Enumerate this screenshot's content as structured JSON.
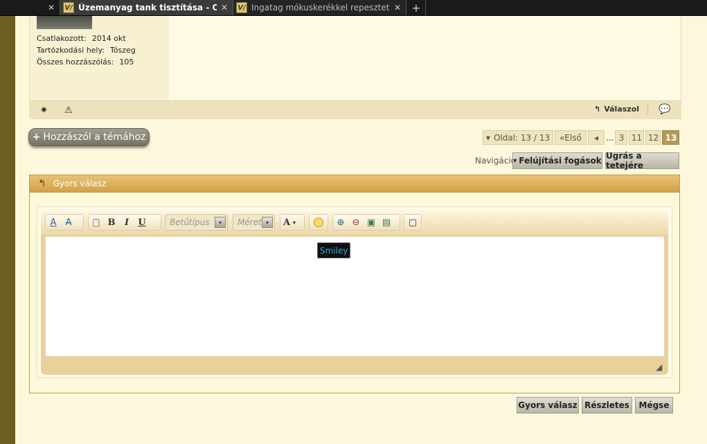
{
  "tabs": [
    {
      "title": "Üzemanyag tank tisztítása - Oldal ...",
      "favicon": "V/",
      "close": "✕"
    },
    {
      "title": "Ingatag mókuskerékkel repesztettek...",
      "favicon": "V/",
      "close": "✕"
    }
  ],
  "tab_stub_close": "✕",
  "new_tab": "+",
  "user": {
    "joined_label": "Csatlakozott:",
    "joined_value": "2014 okt",
    "location_label": "Tartózkodási hely:",
    "location_value": "Tószeg",
    "posts_label": "Összes hozzászólás:",
    "posts_value": "105"
  },
  "post_footer": {
    "star_icon": "✷",
    "warn_icon": "⚠",
    "reply_icon": "↰",
    "reply_label": "Válaszol",
    "quote_icon": "💬"
  },
  "add_post": {
    "plus": "+",
    "label": "Hozzászól a témához"
  },
  "pager": {
    "dropdown_arrow": "▾",
    "page_label": "Oldal: 13 / 13",
    "first_label": "Első",
    "first_icon": "«",
    "prev_icon": "◂",
    "ellipsis": "...",
    "pages": [
      "3",
      "11",
      "12",
      "13"
    ],
    "current": "13"
  },
  "navigation": {
    "label": "Navigáció",
    "tricks_button": "Felújítási fogások",
    "tricks_arrow": "▾",
    "top_button": "Ugrás a tetejére"
  },
  "quick_reply": {
    "header_icon": "↰",
    "title": "Gyors válasz",
    "font_placeholder": "Betűtípus",
    "size_placeholder": "Méret",
    "combo_arrow": "▾",
    "tooltip": "Smiley",
    "toolbar": {
      "remove_format": "A",
      "clean": "A",
      "paste": "📋",
      "bold": "B",
      "italic": "I",
      "underline": "U",
      "color": "A",
      "color_arrow": "▾",
      "link": "⊕",
      "unlink": "⊖",
      "image": "▣",
      "media": "▤",
      "quote": "▢"
    },
    "resize": "◢"
  },
  "buttons": {
    "quick_reply": "Gyors válasz",
    "details": "Részletes",
    "cancel": "Mégse"
  },
  "colors": {
    "page_bg": "#fdf8dc",
    "frame_olive": "#6d5f1e",
    "header_gold": "#d9ad55",
    "current_page": "#b39a57",
    "tooltip_text": "#3aa8d8"
  }
}
